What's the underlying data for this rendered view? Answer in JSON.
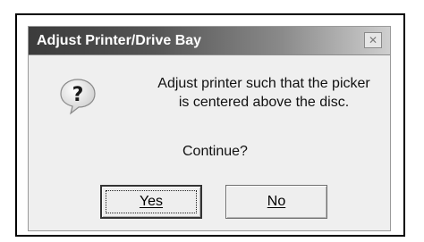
{
  "dialog": {
    "title": "Adjust Printer/Drive Bay",
    "close_glyph": "✕",
    "icon": "question-icon",
    "message_line1": "Adjust printer such that the picker",
    "message_line2": "is centered above the disc.",
    "prompt": "Continue?",
    "yes_label": "Yes",
    "no_label": "No"
  },
  "colors": {
    "titlebar_dark": "#3b3b3b",
    "titlebar_light": "#cfcfcf",
    "dialog_bg": "#efefef"
  }
}
